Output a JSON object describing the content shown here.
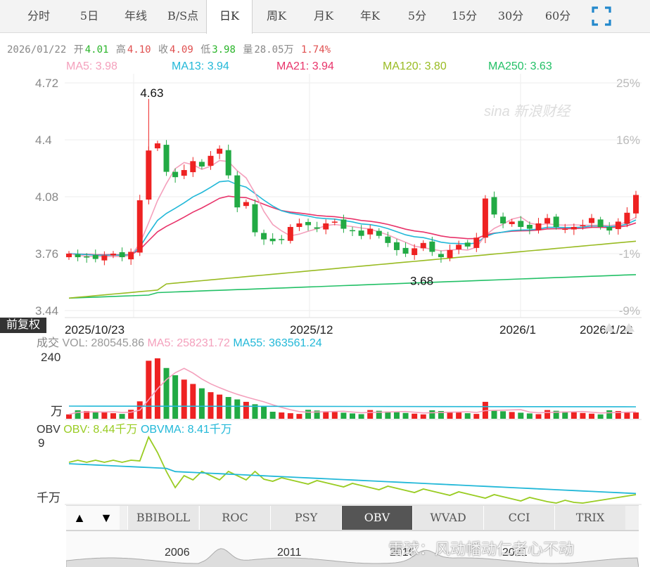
{
  "tabs": [
    {
      "label": "分时",
      "active": false
    },
    {
      "label": "5日",
      "active": false
    },
    {
      "label": "年线",
      "active": false
    },
    {
      "label": "B/S点",
      "active": false
    },
    {
      "label": "日K",
      "active": true
    },
    {
      "label": "周K",
      "active": false
    },
    {
      "label": "月K",
      "active": false
    },
    {
      "label": "年K",
      "active": false
    },
    {
      "label": "5分",
      "active": false
    },
    {
      "label": "15分",
      "active": false
    },
    {
      "label": "30分",
      "active": false
    },
    {
      "label": "60分",
      "active": false
    }
  ],
  "info": {
    "date": "2026/01/22",
    "open_label": "开",
    "open": "4.01",
    "high_label": "高",
    "high": "4.10",
    "close_label": "收",
    "close": "4.09",
    "low_label": "低",
    "low": "3.98",
    "vol_label": "量",
    "vol": "28.05万",
    "pct": "1.74%"
  },
  "ma_legend": [
    {
      "text": "MA5: 3.98",
      "color": "#f4a0bc"
    },
    {
      "text": "MA13: 3.94",
      "color": "#22b8d8"
    },
    {
      "text": "MA21: 3.94",
      "color": "#e8336a"
    },
    {
      "text": "MA120: 3.80",
      "color": "#99bb22"
    },
    {
      "text": "MA250: 3.63",
      "color": "#22c066"
    }
  ],
  "price_axis": {
    "left": [
      "4.72",
      "4.4",
      "4.08",
      "3.76",
      "3.44"
    ],
    "right": [
      "25%",
      "16%",
      "",
      "-1%",
      "-9%"
    ]
  },
  "annotations": {
    "high": "4.63",
    "low": "3.68"
  },
  "date_axis": [
    "2025/10/23",
    "2025/12",
    "2026/1",
    "2026/1/22"
  ],
  "brand_logo": "sina 新浪财经",
  "adjust_badge": "前复权",
  "vol_legend": {
    "label": "成交",
    "vol": "VOL: 280545.86",
    "ma5": "MA5: 258231.72",
    "ma55": "MA55: 363561.24"
  },
  "vol_axis": {
    "top": "240",
    "bottom": "万"
  },
  "obv_legend": {
    "label": "OBV",
    "obv": "OBV: 8.44千万",
    "obvma": "OBVMA: 8.41千万"
  },
  "obv_axis": {
    "top": "9",
    "bottom": "千万"
  },
  "indicator_tabs": [
    {
      "label": "BBIBOLL",
      "active": false
    },
    {
      "label": "ROC",
      "active": false
    },
    {
      "label": "PSY",
      "active": false
    },
    {
      "label": "OBV",
      "active": true
    },
    {
      "label": "WVAD",
      "active": false
    },
    {
      "label": "CCI",
      "active": false
    },
    {
      "label": "TRIX",
      "active": false
    }
  ],
  "arrows": {
    "up": "▲",
    "down": "▼"
  },
  "overview_years": [
    "2006",
    "2011",
    "2016",
    "2021"
  ],
  "watermark": "雪球：风动幡动仁者心不动",
  "colors": {
    "up": "#ee2222",
    "down": "#22aa44",
    "ma5": "#f4a0bc",
    "ma13": "#22b8d8",
    "ma21": "#e8336a",
    "ma120": "#99bb22",
    "ma250": "#22c066",
    "obv": "#99cc22",
    "obvma": "#22b8d8"
  },
  "chart_data": {
    "type": "candlestick",
    "y_range": [
      3.44,
      4.72
    ],
    "series_closes": [
      3.76,
      3.74,
      3.74,
      3.73,
      3.75,
      3.76,
      3.74,
      3.77,
      4.06,
      4.34,
      4.38,
      4.22,
      4.19,
      4.23,
      4.28,
      4.25,
      4.31,
      4.35,
      4.2,
      4.02,
      4.05,
      3.88,
      3.84,
      3.83,
      3.84,
      3.91,
      3.93,
      3.92,
      3.9,
      3.93,
      3.94,
      3.9,
      3.89,
      3.86,
      3.9,
      3.86,
      3.82,
      3.78,
      3.76,
      3.79,
      3.82,
      3.77,
      3.74,
      3.78,
      3.81,
      3.8,
      3.85,
      4.07,
      3.98,
      3.93,
      3.94,
      3.91,
      3.9,
      3.93,
      3.96,
      3.91,
      3.9,
      3.91,
      3.92,
      3.96,
      3.91,
      3.89,
      3.94,
      3.99,
      4.09
    ],
    "annotated_high": 4.63,
    "annotated_low": 3.68
  }
}
